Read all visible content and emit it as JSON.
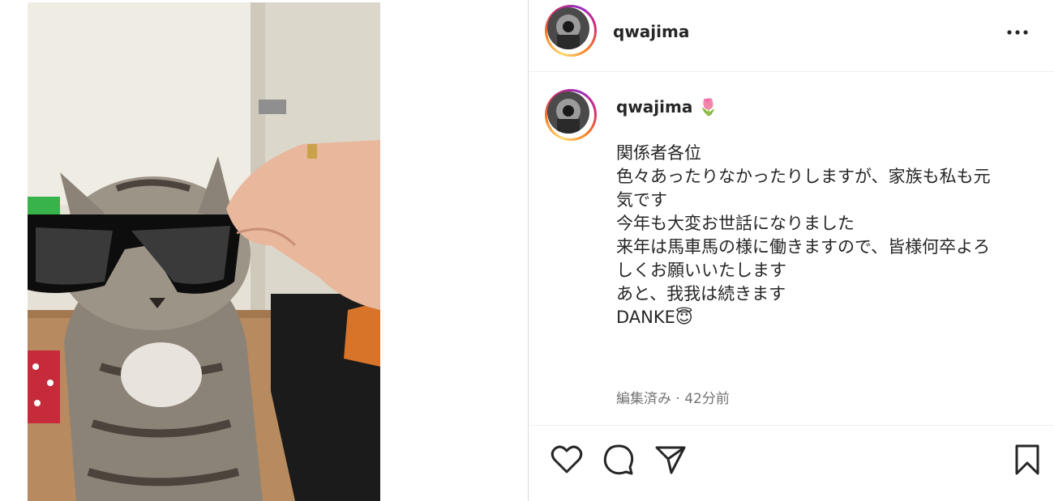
{
  "post": {
    "author": {
      "username": "qwajima"
    },
    "caption": {
      "username": "qwajima",
      "emoji": "🌷",
      "lines": [
        "関係者各位",
        "",
        "色々あったりなかったりしますが、家族も私も元",
        "気です",
        "今年も大変お世話になりました",
        "来年は馬車馬の様に働きますので、皆様何卒よろ",
        "しくお願いいたします",
        "",
        "あと、我我は続きます",
        "DANKE😇"
      ],
      "meta": "編集済み · 42分前"
    },
    "icons": {
      "more": "more-options-icon",
      "like": "heart-icon",
      "comment": "comment-icon",
      "share": "send-icon",
      "save": "bookmark-icon"
    }
  },
  "colors": {
    "text": "#262626",
    "muted": "#737373",
    "divider": "#dbdbdb"
  }
}
